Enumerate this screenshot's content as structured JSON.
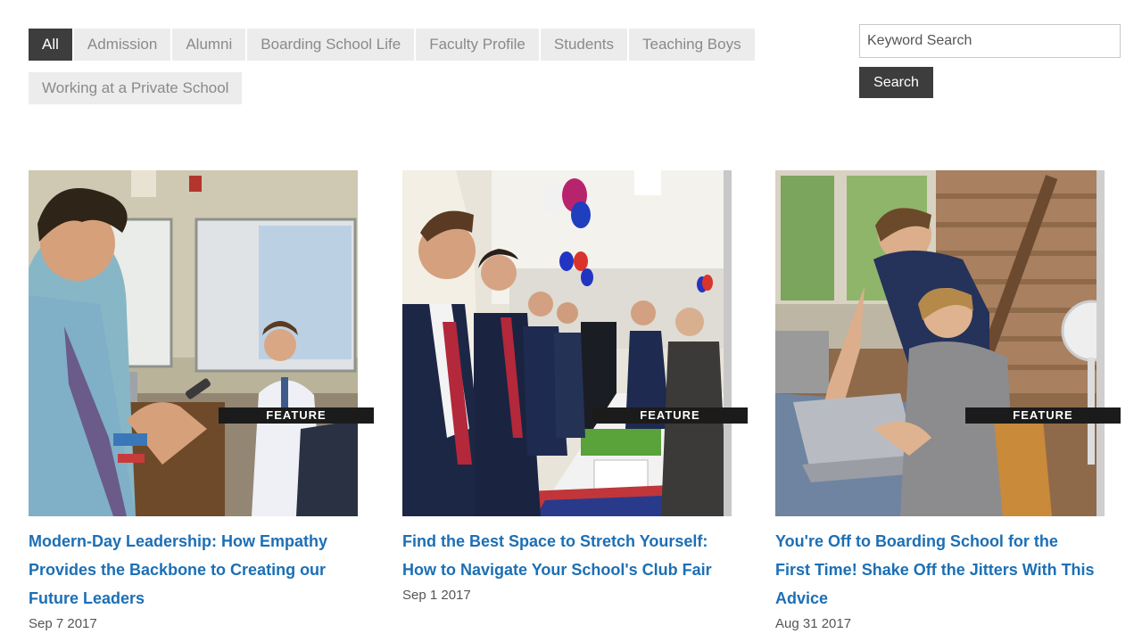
{
  "filters": {
    "row1": [
      "All",
      "Admission",
      "Alumni",
      "Boarding School Life",
      "Faculty Profile",
      "Students",
      "Teaching Boys"
    ],
    "row2": [
      "Working at a Private School"
    ],
    "active": "All"
  },
  "search": {
    "placeholder": "Keyword Search",
    "button_label": "Search"
  },
  "posts": [
    {
      "badge": "FEATURE",
      "title": "Modern-Day Leadership: How Empathy Provides the Backbone to Creating our Future Leaders",
      "date": "Sep 7 2017"
    },
    {
      "badge": "FEATURE",
      "title": "Find the Best Space to Stretch Yourself: How to Navigate Your School's Club Fair",
      "date": "Sep 1 2017"
    },
    {
      "badge": "FEATURE",
      "title": "You're Off to Boarding School for the First Time! Shake Off the Jitters With This Advice",
      "date": "Aug 31 2017"
    }
  ],
  "colors": {
    "accent_link": "#1c6fb5",
    "active_tag_bg": "#3d3d3d",
    "tag_bg": "#ececec"
  }
}
